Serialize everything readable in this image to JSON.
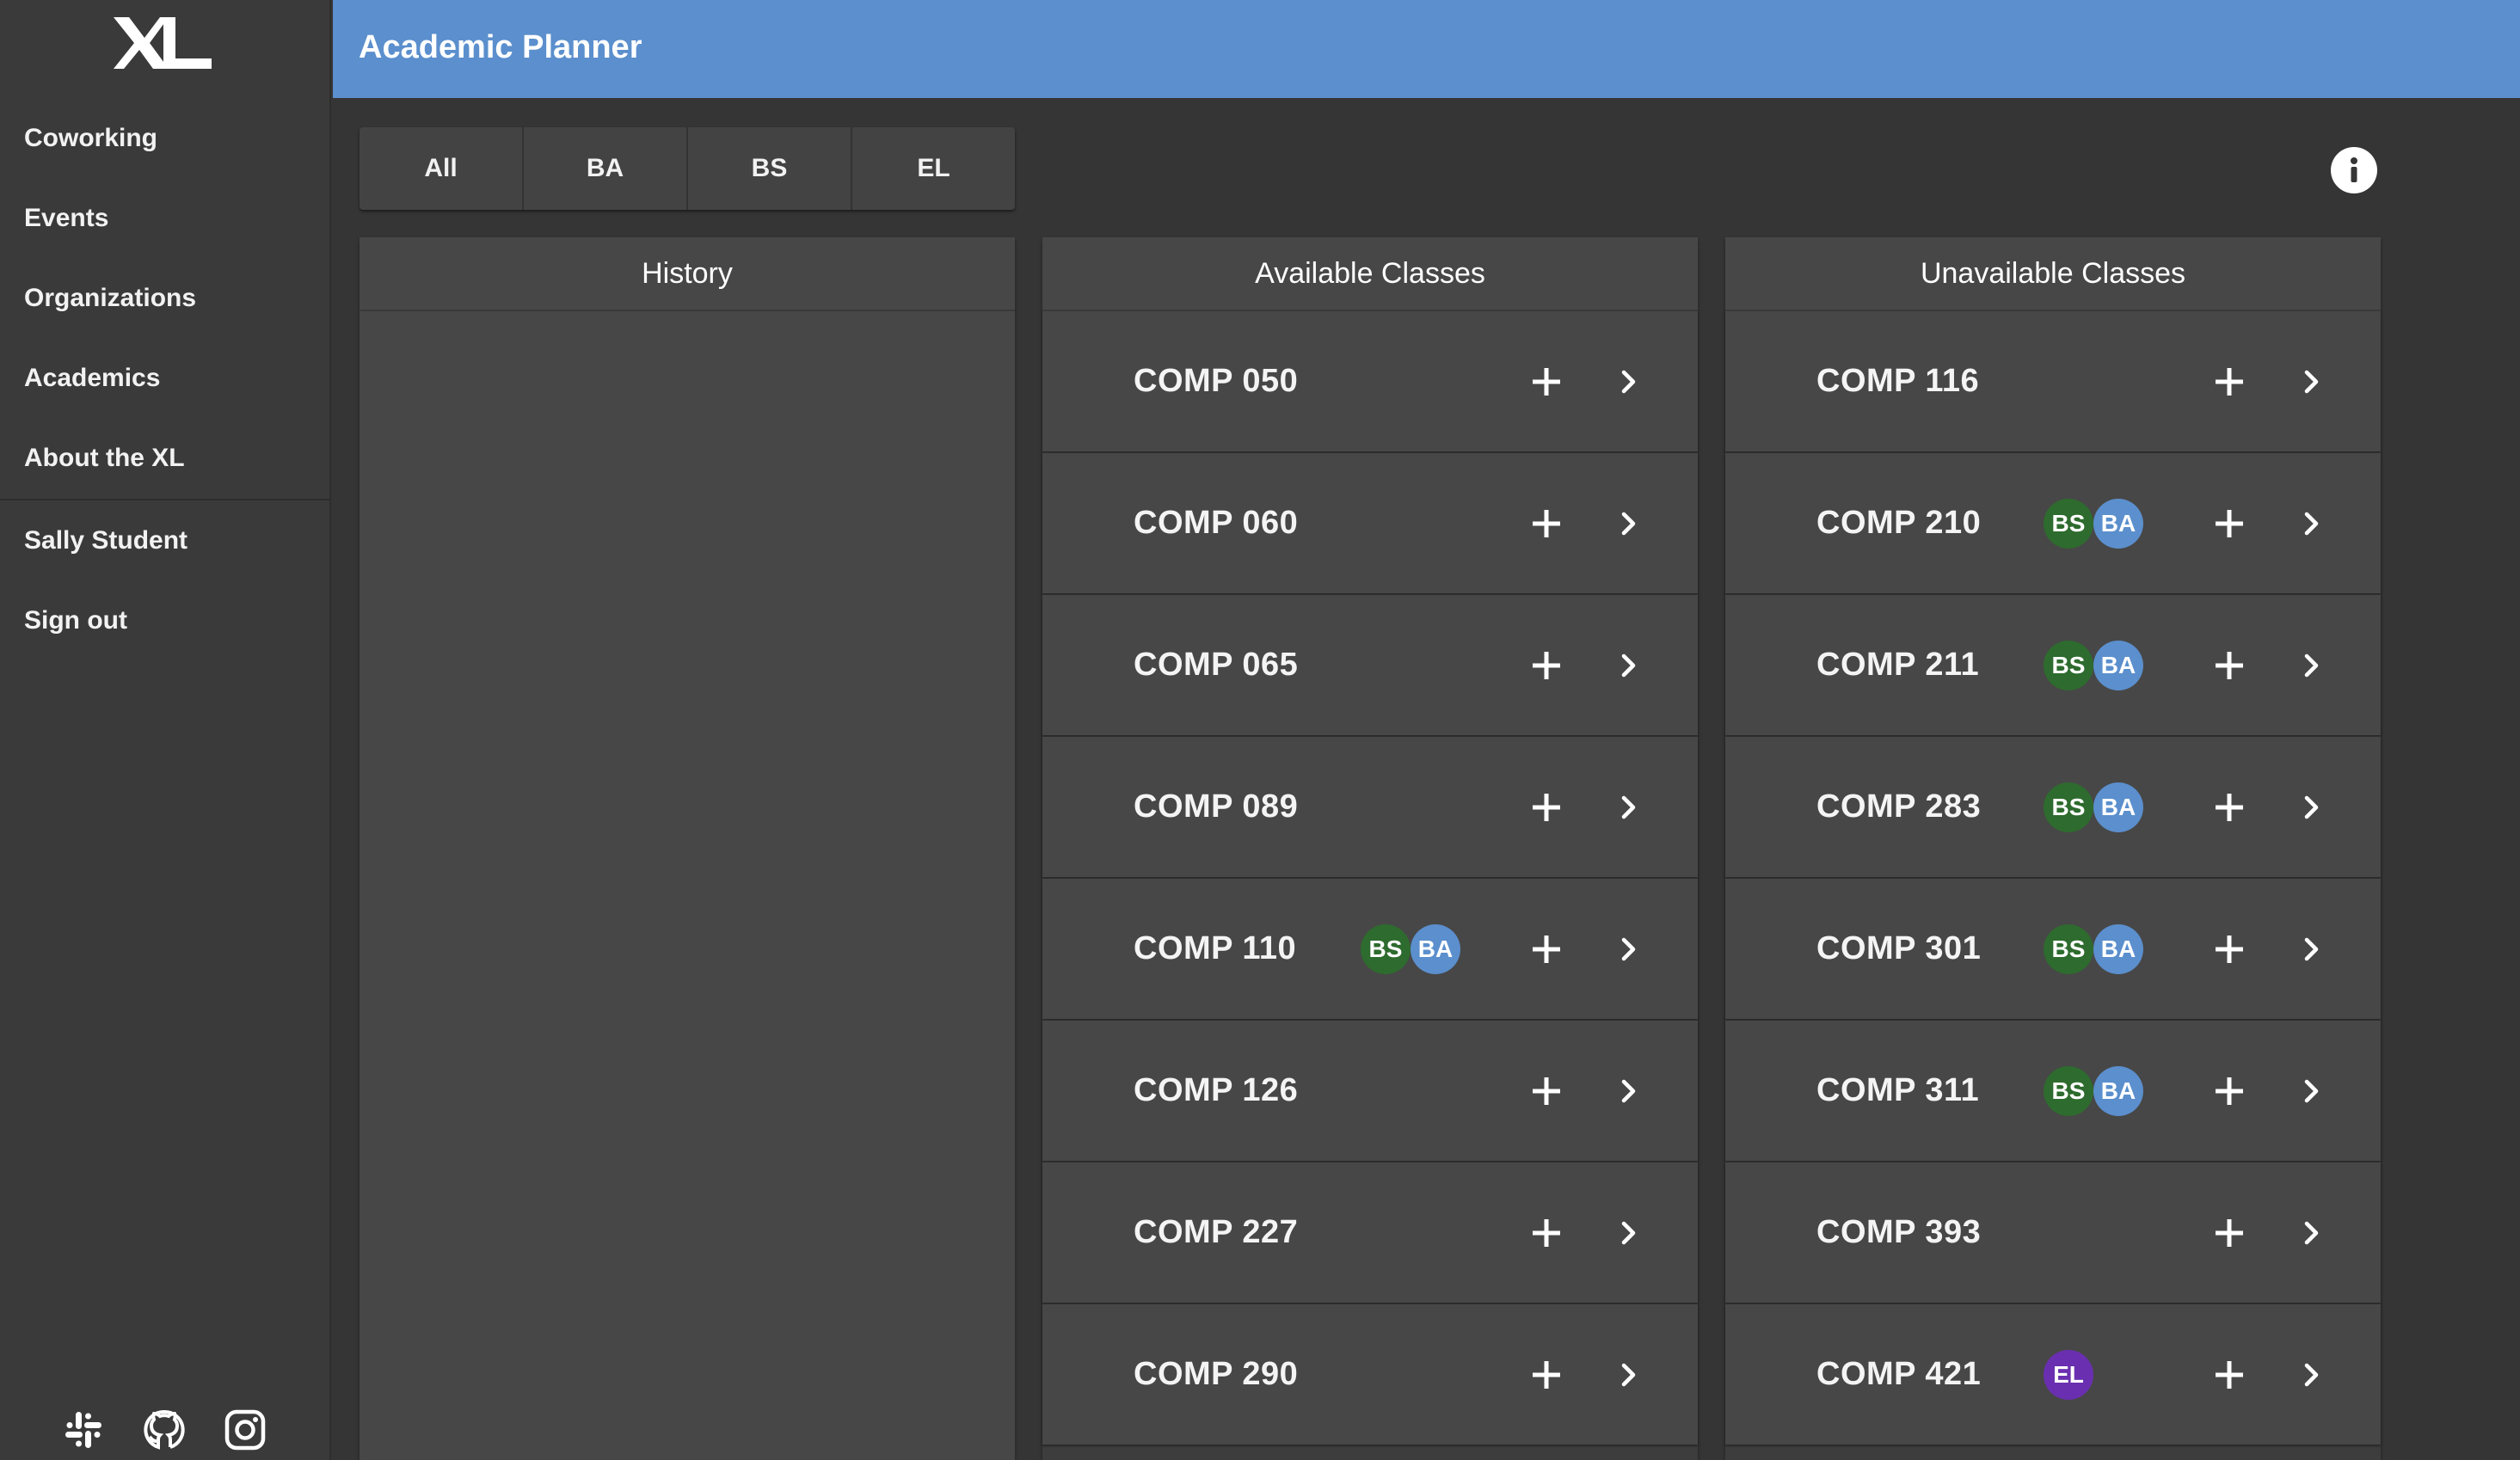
{
  "app": {
    "logo": "XL"
  },
  "sidebar": {
    "items": [
      {
        "label": "Coworking"
      },
      {
        "label": "Events"
      },
      {
        "label": "Organizations"
      },
      {
        "label": "Academics"
      },
      {
        "label": "About the XL"
      }
    ],
    "user_items": [
      {
        "label": "Sally Student"
      },
      {
        "label": "Sign out"
      }
    ],
    "social_icons": [
      "slack-icon",
      "github-icon",
      "instagram-icon"
    ]
  },
  "header": {
    "title": "Academic Planner",
    "color": "#5b8fcd"
  },
  "filters": {
    "tabs": [
      {
        "label": "All"
      },
      {
        "label": "BA"
      },
      {
        "label": "BS"
      },
      {
        "label": "EL"
      }
    ]
  },
  "colors": {
    "BS": "#2e6b2e",
    "BA": "#5b8fcd",
    "EL": "#6a2fb0"
  },
  "columns": {
    "history": {
      "title": "History",
      "classes": []
    },
    "available": {
      "title": "Available Classes",
      "classes": [
        {
          "name": "COMP 050",
          "badges": []
        },
        {
          "name": "COMP 060",
          "badges": []
        },
        {
          "name": "COMP 065",
          "badges": []
        },
        {
          "name": "COMP 089",
          "badges": []
        },
        {
          "name": "COMP 110",
          "badges": [
            "BS",
            "BA"
          ]
        },
        {
          "name": "COMP 126",
          "badges": []
        },
        {
          "name": "COMP 227",
          "badges": []
        },
        {
          "name": "COMP 290",
          "badges": []
        }
      ]
    },
    "unavailable": {
      "title": "Unavailable Classes",
      "classes": [
        {
          "name": "COMP 116",
          "badges": []
        },
        {
          "name": "COMP 210",
          "badges": [
            "BS",
            "BA"
          ]
        },
        {
          "name": "COMP 211",
          "badges": [
            "BS",
            "BA"
          ]
        },
        {
          "name": "COMP 283",
          "badges": [
            "BS",
            "BA"
          ]
        },
        {
          "name": "COMP 301",
          "badges": [
            "BS",
            "BA"
          ]
        },
        {
          "name": "COMP 311",
          "badges": [
            "BS",
            "BA"
          ]
        },
        {
          "name": "COMP 393",
          "badges": []
        },
        {
          "name": "COMP 421",
          "badges": [
            "EL"
          ]
        }
      ]
    }
  }
}
